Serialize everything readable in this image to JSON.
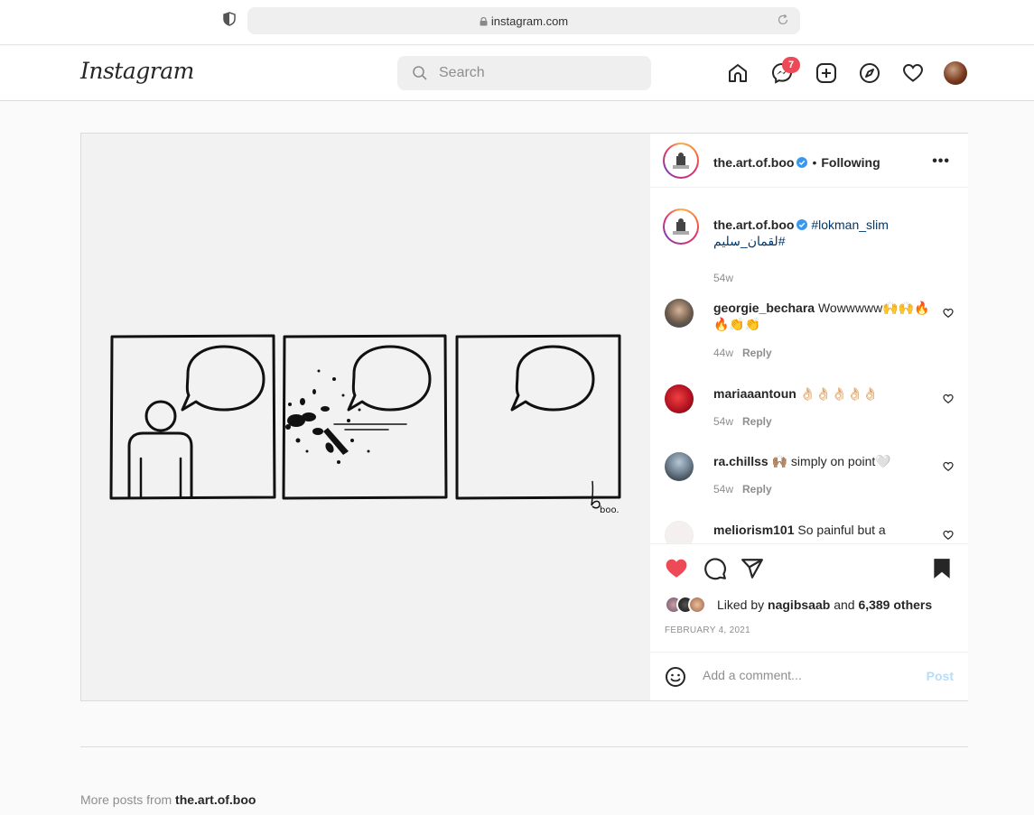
{
  "browser": {
    "url": "instagram.com"
  },
  "nav": {
    "logo": "Instagram",
    "search_placeholder": "Search",
    "messages_badge": "7"
  },
  "post": {
    "author": "the.art.of.boo",
    "follow_status": "Following",
    "separator": "•",
    "more": "•••",
    "caption": {
      "username": "the.art.of.boo",
      "text_line1": "#lokman_slim",
      "text_line2": "لقمان_سليم#",
      "time": "54w"
    },
    "comments": [
      {
        "username": "georgie_bechara",
        "text": "Wowwwww🙌🙌🔥🔥👏👏",
        "time": "44w",
        "reply": "Reply"
      },
      {
        "username": "mariaaantoun",
        "text": "👌🏻👌🏻👌🏻👌🏻👌🏻",
        "time": "54w",
        "reply": "Reply"
      },
      {
        "username": "ra.chillss",
        "text": "🙌🏽 simply on point🤍",
        "time": "54w",
        "reply": "Reply"
      },
      {
        "username": "meliorism101",
        "text": "So painful but a",
        "time": "",
        "reply": ""
      }
    ],
    "likes": {
      "prefix": "Liked by",
      "user": "nagibsaab",
      "and": "and",
      "others": "6,389 others"
    },
    "date": "FEBRUARY 4, 2021",
    "comment_placeholder": "Add a comment...",
    "post_label": "Post",
    "artist_signature": "boo."
  },
  "more_posts": {
    "prefix": "More posts from",
    "user": "the.art.of.boo"
  },
  "colors": {
    "heart_liked": "#ed4956",
    "link_blue": "#00376b",
    "verified_blue": "#3897f0",
    "post_disabled": "#b2dffc"
  }
}
